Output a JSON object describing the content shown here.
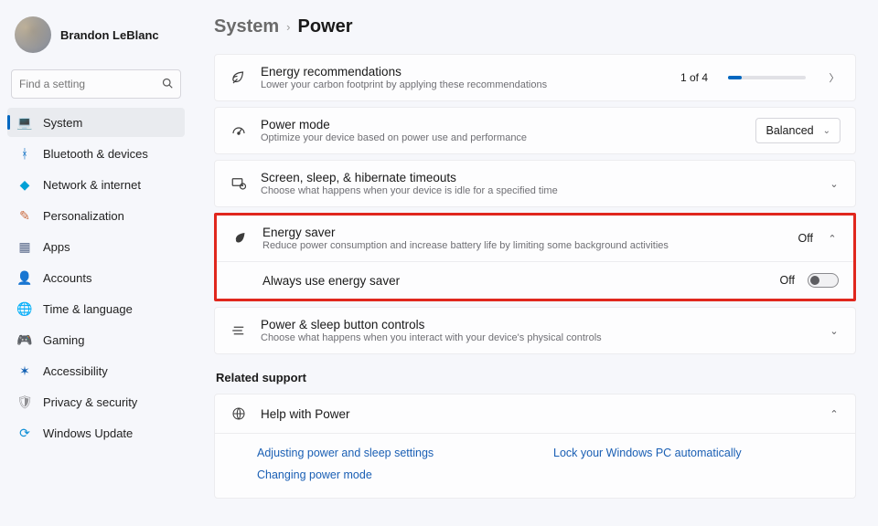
{
  "user": {
    "name": "Brandon LeBlanc"
  },
  "search": {
    "placeholder": "Find a setting"
  },
  "nav": {
    "items": [
      {
        "label": "System",
        "icon": "💻",
        "iconName": "system-icon",
        "color": "#0067c0",
        "selected": true
      },
      {
        "label": "Bluetooth & devices",
        "icon": "ᚼ",
        "iconName": "bluetooth-icon",
        "color": "#0067c0"
      },
      {
        "label": "Network & internet",
        "icon": "◆",
        "iconName": "wifi-icon",
        "color": "#00a1d6"
      },
      {
        "label": "Personalization",
        "icon": "✎",
        "iconName": "brush-icon",
        "color": "#c96a3e"
      },
      {
        "label": "Apps",
        "icon": "▦",
        "iconName": "apps-icon",
        "color": "#5b6b8c"
      },
      {
        "label": "Accounts",
        "icon": "👤",
        "iconName": "person-icon",
        "color": "#1a9c78"
      },
      {
        "label": "Time & language",
        "icon": "🌐",
        "iconName": "globe-icon",
        "color": "#2c7aa8"
      },
      {
        "label": "Gaming",
        "icon": "🎮",
        "iconName": "gamepad-icon",
        "color": "#7c7c7c"
      },
      {
        "label": "Accessibility",
        "icon": "✶",
        "iconName": "accessibility-icon",
        "color": "#0f5fb3"
      },
      {
        "label": "Privacy & security",
        "icon": "🛡",
        "iconName": "shield-icon",
        "color": "#8f8f92"
      },
      {
        "label": "Windows Update",
        "icon": "⟳",
        "iconName": "update-icon",
        "color": "#0f8fd6"
      }
    ]
  },
  "breadcrumb": {
    "parent": "System",
    "current": "Power",
    "sep": "›"
  },
  "rows": {
    "energy_rec": {
      "title": "Energy recommendations",
      "sub": "Lower your carbon footprint by applying these recommendations",
      "progress_label": "1 of 4"
    },
    "power_mode": {
      "title": "Power mode",
      "sub": "Optimize your device based on power use and performance",
      "selected": "Balanced"
    },
    "timeouts": {
      "title": "Screen, sleep, & hibernate timeouts",
      "sub": "Choose what happens when your device is idle for a specified time"
    },
    "energy_saver": {
      "title": "Energy saver",
      "sub": "Reduce power consumption and increase battery life by limiting some background activities",
      "status": "Off",
      "always": {
        "label": "Always use energy saver",
        "status": "Off"
      }
    },
    "buttons": {
      "title": "Power & sleep button controls",
      "sub": "Choose what happens when you interact with your device's physical controls"
    }
  },
  "related": {
    "header": "Related support",
    "help_title": "Help with Power",
    "links": [
      "Adjusting power and sleep settings",
      "Lock your Windows PC automatically",
      "Changing power mode"
    ]
  }
}
